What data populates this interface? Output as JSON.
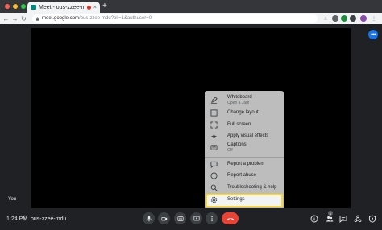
{
  "browser": {
    "tab": {
      "title": "Meet - ous-zzee-mdu",
      "close": "×"
    },
    "new_tab": "+",
    "nav": {
      "back": "←",
      "forward": "→",
      "reload": "↻"
    },
    "url": {
      "host": "meet.google.com",
      "path": "/ous-zzee-mdu?pli=1&authuser=0"
    },
    "traffic_lights": [
      "#ff5f57",
      "#febc2e",
      "#28c840"
    ]
  },
  "meet": {
    "self_label": "You",
    "more_options_glyph": "•••",
    "menu": {
      "items": [
        {
          "label": "Whiteboard",
          "sub": "Open a Jam",
          "icon": "whiteboard-icon"
        },
        {
          "label": "Change layout",
          "icon": "layout-icon"
        },
        {
          "label": "Full screen",
          "icon": "fullscreen-icon"
        },
        {
          "label": "Apply visual effects",
          "icon": "sparkle-icon"
        },
        {
          "label": "Captions",
          "sub": "Off",
          "icon": "captions-icon"
        },
        {
          "label": "Report a problem",
          "icon": "report-problem-icon"
        },
        {
          "label": "Report abuse",
          "icon": "report-abuse-icon"
        },
        {
          "label": "Troubleshooting & help",
          "icon": "troubleshoot-icon"
        },
        {
          "label": "Settings",
          "icon": "settings-icon",
          "highlighted": true
        }
      ]
    },
    "bottom": {
      "time": "1:24 PM",
      "separator": "|",
      "meeting_code": "ous-zzee-mdu",
      "people_count": "1"
    },
    "colors": {
      "end_call": "#ea4335",
      "highlight": "#fdd835",
      "accent": "#1a73e8"
    }
  }
}
